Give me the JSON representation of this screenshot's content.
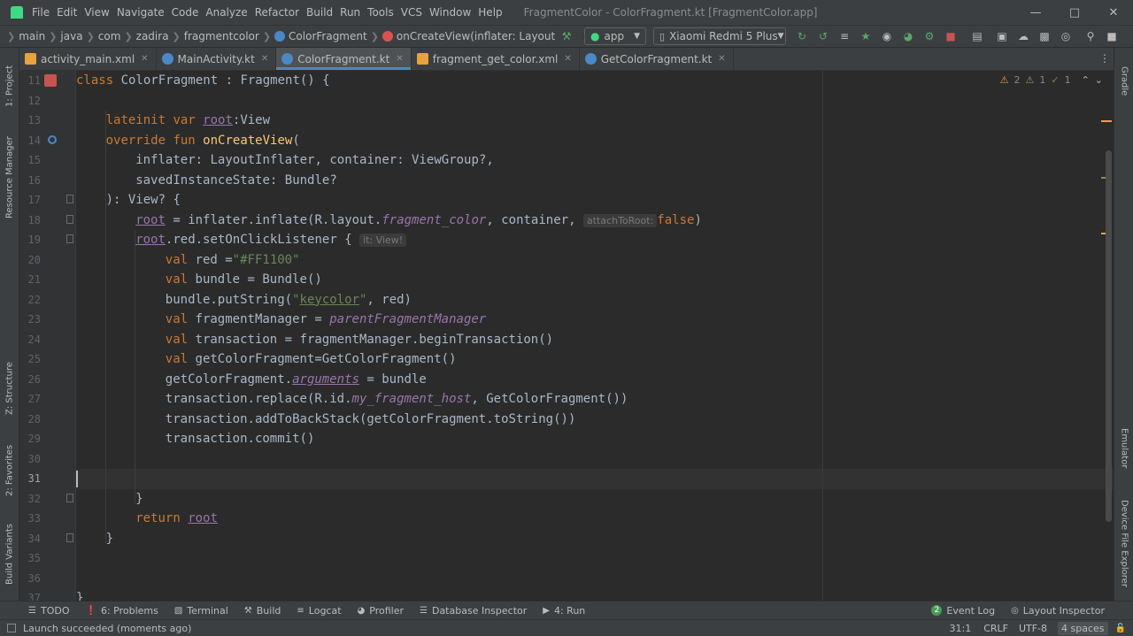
{
  "menu": {
    "items": [
      "File",
      "Edit",
      "View",
      "Navigate",
      "Code",
      "Analyze",
      "Refactor",
      "Build",
      "Run",
      "Tools",
      "VCS",
      "Window",
      "Help"
    ],
    "window_title": "FragmentColor - ColorFragment.kt [FragmentColor.app]"
  },
  "breadcrumbs": [
    "main",
    "java",
    "com",
    "zadira",
    "fragmentcolor",
    "ColorFragment",
    "onCreateView(inflater: LayoutInflater, containe..."
  ],
  "run_config": "app",
  "device": "Xiaomi Redmi 5 Plus",
  "tabs": [
    {
      "label": "activity_main.xml",
      "icon": "xml-file-icon",
      "active": false
    },
    {
      "label": "MainActivity.kt",
      "icon": "kotlin-class-icon",
      "active": false
    },
    {
      "label": "ColorFragment.kt",
      "icon": "kotlin-class-icon",
      "active": true
    },
    {
      "label": "fragment_get_color.xml",
      "icon": "xml-file-icon",
      "active": false
    },
    {
      "label": "GetColorFragment.kt",
      "icon": "kotlin-class-icon",
      "active": false
    }
  ],
  "left_tools": [
    "1: Project",
    "Resource Manager",
    "Z: Structure",
    "2: Favorites",
    "Build Variants"
  ],
  "right_tools": [
    "Gradle",
    "Emulator",
    "Device File Explorer"
  ],
  "inspections": {
    "warnings": "2",
    "weak_warnings": "1",
    "typos": "1"
  },
  "editor": {
    "line_numbers": [
      "11",
      "12",
      "13",
      "14",
      "15",
      "16",
      "17",
      "18",
      "19",
      "20",
      "21",
      "22",
      "23",
      "24",
      "25",
      "26",
      "27",
      "28",
      "29",
      "30",
      "31",
      "32",
      "33",
      "34",
      "35",
      "36",
      "37"
    ],
    "current_line": "31",
    "code": {
      "l11_kw": "class ",
      "l11_rest": "ColorFragment : Fragment() {",
      "l13_kw": "lateinit var ",
      "l13_prop": "root",
      "l13_rest": ":View",
      "l14_kw": "override fun ",
      "l14_fn": "onCreateView",
      "l14_rest": "(",
      "l15": "inflater: LayoutInflater, container: ViewGroup?,",
      "l16": "savedInstanceState: Bundle?",
      "l17": "): View? {",
      "l18_prop": "root",
      "l18_a": " = inflater.inflate(R.layout.",
      "l18_it": "fragment_color",
      "l18_b": ", container, ",
      "l18_hint": "attachToRoot:",
      "l18_kw": "false",
      "l18_end": ")",
      "l19_prop": "root",
      "l19_rest": ".red.setOnClickListener { ",
      "l19_hint": "it: View!",
      "l20_kw": "val ",
      "l20_a": "red =",
      "l20_str": "\"#FF1100\"",
      "l21_kw": "val ",
      "l21_rest": "bundle = Bundle()",
      "l22_a": "bundle.putString(",
      "l22_q1": "\"",
      "l22_str": "keycolor",
      "l22_q2": "\"",
      "l22_b": ", red)",
      "l23_kw": "val ",
      "l23_a": "fragmentManager = ",
      "l23_prop": "parentFragmentManager",
      "l24_kw": "val ",
      "l24_rest": "transaction = fragmentManager.beginTransaction()",
      "l25_kw": "val ",
      "l25_rest": "getColorFragment=GetColorFragment()",
      "l26_a": "getColorFragment.",
      "l26_prop": "arguments",
      "l26_b": " = bundle",
      "l27_a": "transaction.replace(R.id.",
      "l27_it": "my_fragment_host",
      "l27_b": ", GetColorFragment())",
      "l28": "transaction.addToBackStack(getColorFragment.toString())",
      "l29": "transaction.commit()",
      "l32": "}",
      "l33_kw": "return ",
      "l33_prop": "root",
      "l34": "}",
      "l37": "}"
    }
  },
  "bottom_tools": [
    {
      "icon": "todo-icon",
      "label": "TODO"
    },
    {
      "icon": "problems-icon",
      "label": "6: Problems"
    },
    {
      "icon": "terminal-icon",
      "label": "Terminal"
    },
    {
      "icon": "build-hammer-icon",
      "label": "Build"
    },
    {
      "icon": "logcat-icon",
      "label": "Logcat"
    },
    {
      "icon": "profiler-icon",
      "label": "Profiler"
    },
    {
      "icon": "database-icon",
      "label": "Database Inspector"
    },
    {
      "icon": "run-icon",
      "label": "4: Run"
    }
  ],
  "event_log": {
    "count": "2",
    "label": "Event Log"
  },
  "layout_inspector": "Layout Inspector",
  "status": {
    "message": "Launch succeeded (moments ago)",
    "position": "31:1",
    "line_separator": "CRLF",
    "encoding": "UTF-8",
    "indent": "4 spaces"
  }
}
